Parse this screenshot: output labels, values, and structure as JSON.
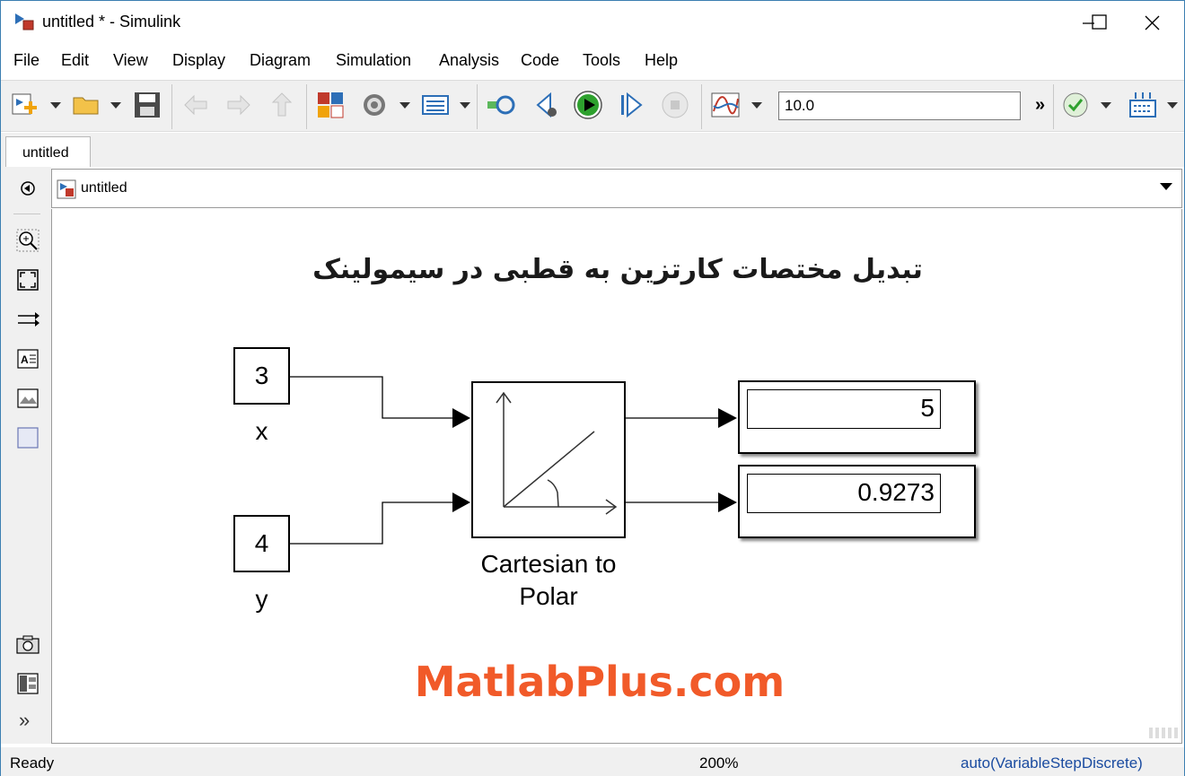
{
  "window": {
    "title": "untitled * - Simulink"
  },
  "menu": {
    "items": [
      "File",
      "Edit",
      "View",
      "Display",
      "Diagram",
      "Simulation",
      "Analysis",
      "Code",
      "Tools",
      "Help"
    ]
  },
  "toolbar": {
    "stop_time": "10.0",
    "more_label": "»"
  },
  "tabs": [
    {
      "label": "untitled"
    }
  ],
  "address": {
    "path": "untitled"
  },
  "palette": {
    "more_label": "»"
  },
  "diagram": {
    "title": "تبدیل مختصات کارتزین به قطبی در سیمولینک",
    "watermark": "MatlabPlus.com",
    "constant_x": {
      "value": "3",
      "label": "x"
    },
    "constant_y": {
      "value": "4",
      "label": "y"
    },
    "converter": {
      "label_line1": "Cartesian to",
      "label_line2": "Polar"
    },
    "display_magnitude": {
      "value": "5"
    },
    "display_angle": {
      "value": "0.9273"
    }
  },
  "status": {
    "state": "Ready",
    "zoom": "200%",
    "solver": "auto(VariableStepDiscrete)"
  },
  "colors": {
    "watermark": "#f15a29",
    "run_button": "#2ea12e",
    "solver_text": "#1a4ba0"
  }
}
